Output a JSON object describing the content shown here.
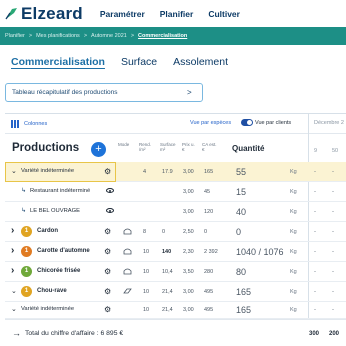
{
  "app": {
    "logo_text": "Elzeard",
    "nav": [
      "Paramétrer",
      "Planifier",
      "Cultiver"
    ]
  },
  "breadcrumb": [
    "Planifier",
    "Mes planifications",
    "Automne 2021",
    "Commercialisation"
  ],
  "page_tabs": [
    "Commercialisation",
    "Surface",
    "Assolement"
  ],
  "recap_button": {
    "label": "Tableau récapitulatif des productions",
    "arrow": ">"
  },
  "toolbar": {
    "columns_label": "Colonnes",
    "view_species": "Vue par espèces",
    "view_clients": "Vue par clients",
    "toggle_on": true,
    "month": "Décembre 2"
  },
  "table_header": {
    "title": "Productions",
    "add": "+",
    "mode": "Mode",
    "rend": "Rend.",
    "rend_unit": "/m²",
    "surface": "Surface",
    "surface_unit": "m²",
    "prix": "Prix u.",
    "prix_unit": "€",
    "ca": "CA est.",
    "ca_unit": "€",
    "quantite": "Quantité",
    "week1": "9",
    "week2": "50"
  },
  "rows": [
    {
      "label": "Variété indéterminée",
      "rend": "4",
      "surface": "17.9",
      "prix": "3,00",
      "ca": "165",
      "qty": "55",
      "unit": "Kg",
      "d1": "-",
      "d2": "-"
    },
    {
      "label": "Restaurant indéterminé",
      "prix": "3,00",
      "ca": "45",
      "qty": "15",
      "unit": "Kg",
      "d1": "-",
      "d2": "-"
    },
    {
      "label": "LE BEL OUVRAGE",
      "prix": "3,00",
      "ca": "120",
      "qty": "40",
      "unit": "Kg",
      "d1": "-",
      "d2": "-"
    },
    {
      "label": "Cardon",
      "badge": "1",
      "badge_color": "#e0a422",
      "rend": "8",
      "surface": "0",
      "prix": "2,50",
      "ca": "0",
      "qty": "0",
      "unit": "Kg",
      "d1": "-",
      "d2": "-"
    },
    {
      "label": "Carotte d'automne",
      "badge": "1",
      "badge_color": "#e07b22",
      "rend": "10",
      "surface": "140",
      "prix": "2,30",
      "ca": "2 392",
      "qty": "1040 / 1076",
      "unit": "Kg",
      "d1": "-",
      "d2": "-"
    },
    {
      "label": "Chicorée frisée",
      "badge": "1",
      "badge_color": "#6fa83a",
      "rend": "10",
      "surface": "10,4",
      "prix": "3,50",
      "ca": "280",
      "qty": "80",
      "unit": "Kg",
      "d1": "-",
      "d2": "-"
    },
    {
      "label": "Chou-rave",
      "badge": "1",
      "badge_color": "#e0a422",
      "rend": "10",
      "surface": "21,4",
      "prix": "3,00",
      "ca": "495",
      "qty": "165",
      "unit": "Kg",
      "d1": "-",
      "d2": "-"
    },
    {
      "label": "Variété indéterminée",
      "rend": "10",
      "surface": "21,4",
      "prix": "3,00",
      "ca": "495",
      "qty": "165",
      "unit": "Kg",
      "d1": "-",
      "d2": "-"
    }
  ],
  "total": {
    "arrow": "→",
    "label": "Total du chiffre d'affaire : 6 895 €",
    "v1": "300",
    "v2": "200"
  }
}
